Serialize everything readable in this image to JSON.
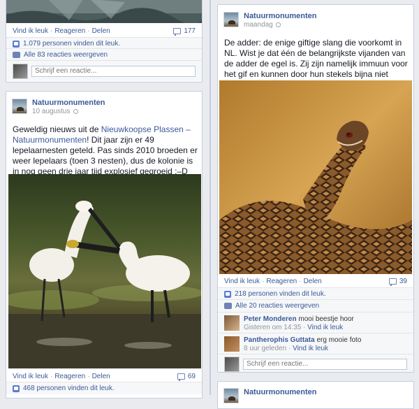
{
  "labels": {
    "like": "Vind ik leuk",
    "comment": "Reageren",
    "share": "Delen",
    "write_comment_placeholder": "Schrijf een reactie...",
    "comment_like": "Vind ik leuk",
    "sep": "·"
  },
  "post_top_left": {
    "comments_count": "177",
    "likes_text": "1.079 personen vinden dit leuk.",
    "view_comments": "Alle 83 reacties weergeven"
  },
  "post_left": {
    "page_name": "Natuurmonumenten",
    "date": "10 augustus",
    "text_before": "Geweldig nieuws uit de ",
    "text_link": "Nieuwkoopse Plassen – Natuurmonumenten",
    "text_after": "! Dit jaar zijn er 49 lepelaarnesten geteld. Pas sinds 2010 broeden er weer lepelaars (toen 3 nesten), dus de kolonie is in nog geen drie jaar tijd explosief gegroeid :–D",
    "comments_count": "69",
    "likes_text": "468 personen vinden dit leuk."
  },
  "post_right": {
    "page_name": "Natuurmonumenten",
    "date": "maandag",
    "text": "De adder: de enige giftige slang die voorkomt in NL. Wist je dat één de belangrijkste vijanden van de adder de egel is. Zij zijn namelijk immuun voor het gif en kunnen door hun stekels bijna niet gebeten worden :-)",
    "comments_count": "39",
    "likes_text": "218 personen vinden dit leuk.",
    "view_comments": "Alle 20 reacties weergeven",
    "comments": [
      {
        "author": "Peter Monderen",
        "text": "mooi beestje hoor",
        "time": "Gisteren om 14:35"
      },
      {
        "author": "Pantherophis Guttata",
        "text": "erg mooie foto",
        "time": "8 uur geleden"
      }
    ]
  },
  "post_bottom_right": {
    "page_name": "Natuurmonumenten"
  },
  "colors": {
    "link": "#3b5998",
    "timeline": "#c4cde0",
    "background": "#e9ebee"
  }
}
